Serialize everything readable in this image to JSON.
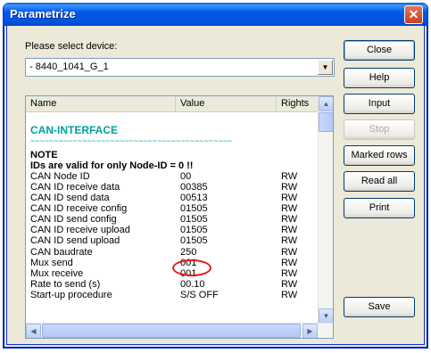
{
  "window": {
    "title": "Parametrize",
    "close_glyph": "✕"
  },
  "device": {
    "label": "Please select device:",
    "label_key": "d",
    "selected": "- 8440_1041_G_1"
  },
  "list": {
    "columns": {
      "name": "Name",
      "value": "Value",
      "rights": "Rights"
    },
    "section_title": "CAN-INTERFACE",
    "section_rule": "~~~~~~~~~~~~~~~~~~~~~~~~~~~~~~~~~~~~~~~~~~~",
    "note_title": "NOTE",
    "note_text": "IDs are valid for only Node-ID = 0 !!",
    "rows": [
      {
        "name": "CAN Node ID",
        "value": "00",
        "rights": "RW"
      },
      {
        "name": "CAN ID receive data",
        "value": "00385",
        "rights": "RW"
      },
      {
        "name": "CAN ID send data",
        "value": "00513",
        "rights": "RW"
      },
      {
        "name": "CAN ID receive config",
        "value": "01505",
        "rights": "RW"
      },
      {
        "name": "CAN ID send config",
        "value": "01505",
        "rights": "RW"
      },
      {
        "name": "CAN ID receive upload",
        "value": "01505",
        "rights": "RW"
      },
      {
        "name": "CAN ID send upload",
        "value": "01505",
        "rights": "RW"
      },
      {
        "name": "CAN baudrate",
        "value": "250",
        "rights": "RW"
      },
      {
        "name": "Mux send",
        "value": "001",
        "rights": "RW"
      },
      {
        "name": "Mux receive",
        "value": "001",
        "rights": "RW"
      },
      {
        "name": "Rate to send (s)",
        "value": "00.10",
        "rights": "RW"
      },
      {
        "name": "Start-up procedure",
        "value": "S/S OFF",
        "rights": "RW"
      }
    ]
  },
  "buttons": {
    "close": "Close",
    "help": "Help",
    "input": "Input",
    "stop": "Stop",
    "marked_rows": "Marked rows",
    "read_all": "Read all",
    "print": "Print",
    "save": "Save"
  },
  "icons": {
    "combo_arrow": "▼",
    "scroll_up": "▲",
    "scroll_down": "▼",
    "scroll_left": "◀",
    "scroll_right": "▶"
  }
}
